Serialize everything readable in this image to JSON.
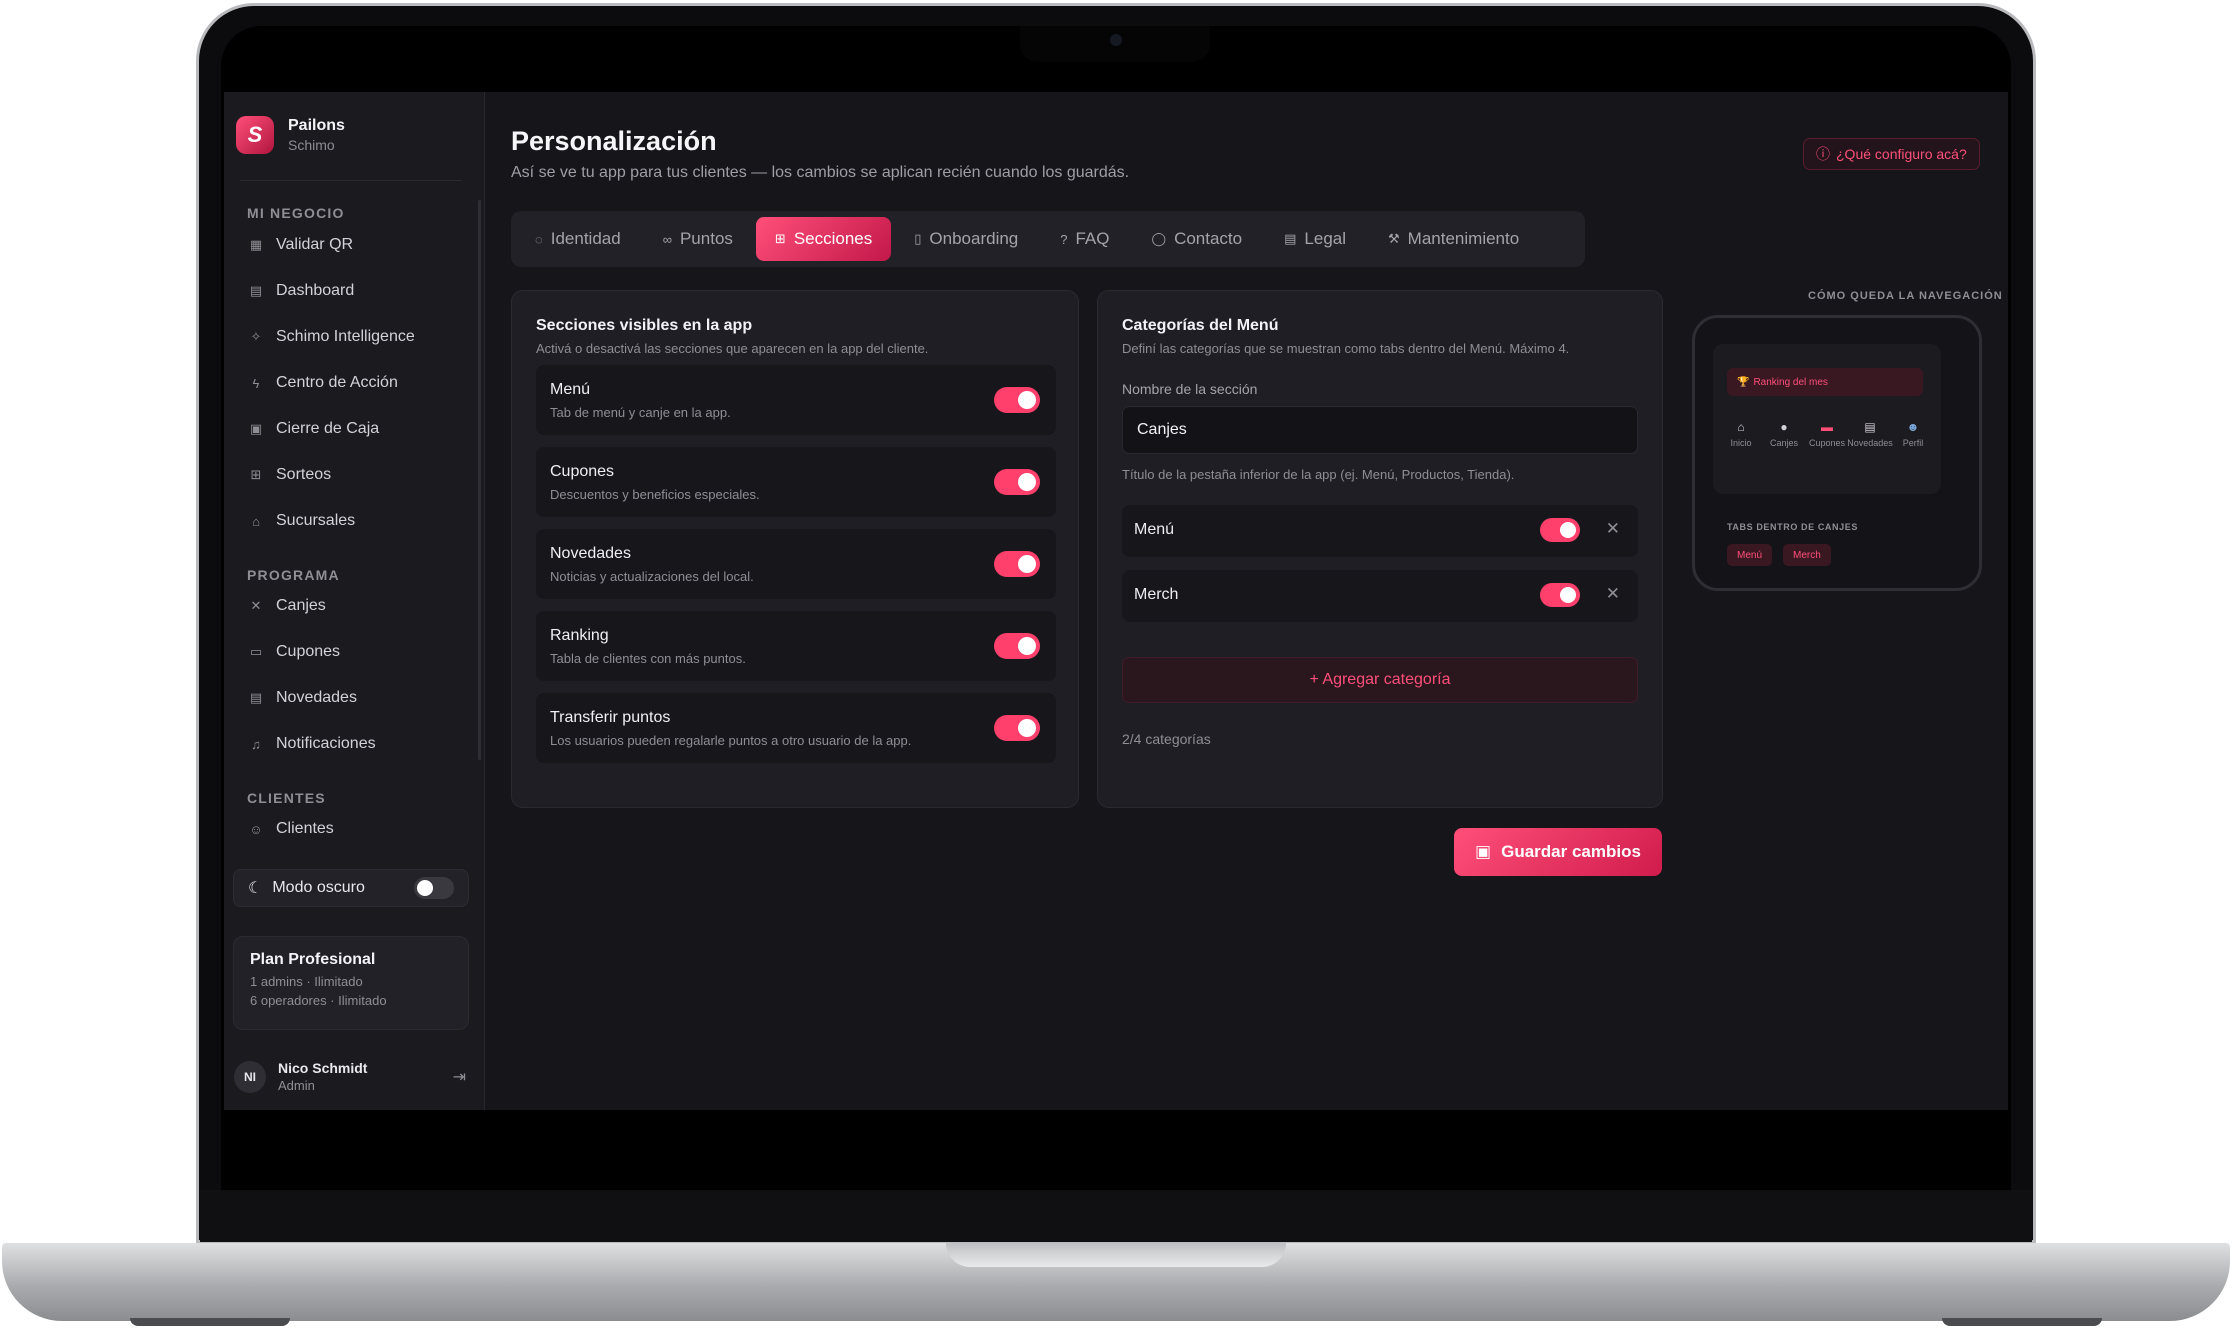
{
  "brand": {
    "name": "Pailons",
    "sub": "Schimo",
    "logo_letter": "S"
  },
  "sidebar": {
    "sections": [
      {
        "label": "MI NEGOCIO",
        "items": [
          {
            "label": "Validar QR",
            "icon": "qr-icon"
          },
          {
            "label": "Dashboard",
            "icon": "dashboard-icon"
          },
          {
            "label": "Schimo Intelligence",
            "icon": "sparkles-icon"
          },
          {
            "label": "Centro de Acción",
            "icon": "bolt-icon"
          },
          {
            "label": "Cierre de Caja",
            "icon": "calculator-icon"
          },
          {
            "label": "Sorteos",
            "icon": "gift-icon"
          },
          {
            "label": "Sucursales",
            "icon": "store-icon"
          }
        ]
      },
      {
        "label": "PROGRAMA",
        "items": [
          {
            "label": "Canjes",
            "icon": "utensils-icon"
          },
          {
            "label": "Cupones",
            "icon": "ticket-icon"
          },
          {
            "label": "Novedades",
            "icon": "newspaper-icon"
          },
          {
            "label": "Notificaciones",
            "icon": "bell-icon"
          }
        ]
      },
      {
        "label": "CLIENTES",
        "items": [
          {
            "label": "Clientes",
            "icon": "users-icon"
          }
        ]
      }
    ],
    "dark_mode_label": "Modo oscuro",
    "plan": {
      "title": "Plan Profesional",
      "line1": "1 admins · Ilimitado",
      "line2": "6 operadores · Ilimitado"
    },
    "user": {
      "initials": "NI",
      "name": "Nico Schmidt",
      "role": "Admin"
    }
  },
  "header": {
    "title": "Personalización",
    "subtitle": "Así se ve tu app para tus clientes — los cambios se aplican recién cuando los guardás.",
    "help_label": "¿Qué configuro acá?"
  },
  "tabs": [
    {
      "label": "Identidad",
      "icon": "palette-icon"
    },
    {
      "label": "Puntos",
      "icon": "link-icon"
    },
    {
      "label": "Secciones",
      "icon": "grid-icon",
      "active": true
    },
    {
      "label": "Onboarding",
      "icon": "book-icon"
    },
    {
      "label": "FAQ",
      "icon": "help-circle-icon"
    },
    {
      "label": "Contacto",
      "icon": "chat-icon"
    },
    {
      "label": "Legal",
      "icon": "document-icon"
    },
    {
      "label": "Mantenimiento",
      "icon": "wrench-icon"
    }
  ],
  "sections_card": {
    "title": "Secciones visibles en la app",
    "subtitle": "Activá o desactivá las secciones que aparecen en la app del cliente.",
    "items": [
      {
        "name": "Menú",
        "desc": "Tab de menú y canje en la app.",
        "enabled": true
      },
      {
        "name": "Cupones",
        "desc": "Descuentos y beneficios especiales.",
        "enabled": true
      },
      {
        "name": "Novedades",
        "desc": "Noticias y actualizaciones del local.",
        "enabled": true
      },
      {
        "name": "Ranking",
        "desc": "Tabla de clientes con más puntos.",
        "enabled": true
      },
      {
        "name": "Transferir puntos",
        "desc": "Los usuarios pueden regalarle puntos a otro usuario de la app.",
        "enabled": true
      }
    ]
  },
  "categories_card": {
    "title": "Categorías del Menú",
    "subtitle": "Definí las categorías que se muestran como tabs dentro del Menú. Máximo 4.",
    "field_label": "Nombre de la sección",
    "field_value": "Canjes",
    "field_help": "Título de la pestaña inferior de la app (ej. Menú, Productos, Tienda).",
    "categories": [
      {
        "name": "Menú",
        "enabled": true
      },
      {
        "name": "Merch",
        "enabled": true
      }
    ],
    "add_label": "+ Agregar categoría",
    "count_label": "2/4 categorías"
  },
  "save_label": "Guardar cambios",
  "preview": {
    "label": "CÓMO QUEDA LA NAVEGACIÓN",
    "banner": "Ranking del mes",
    "nav": [
      "Inicio",
      "Canjes",
      "Cupones",
      "Novedades",
      "Perfil"
    ],
    "tabs_caption": "TABS DENTRO DE CANJES",
    "chips": [
      "Menú",
      "Merch"
    ]
  },
  "colors": {
    "accent": "#ff3f6c",
    "background": "#16151a",
    "sidebar": "#1b1a1f"
  }
}
